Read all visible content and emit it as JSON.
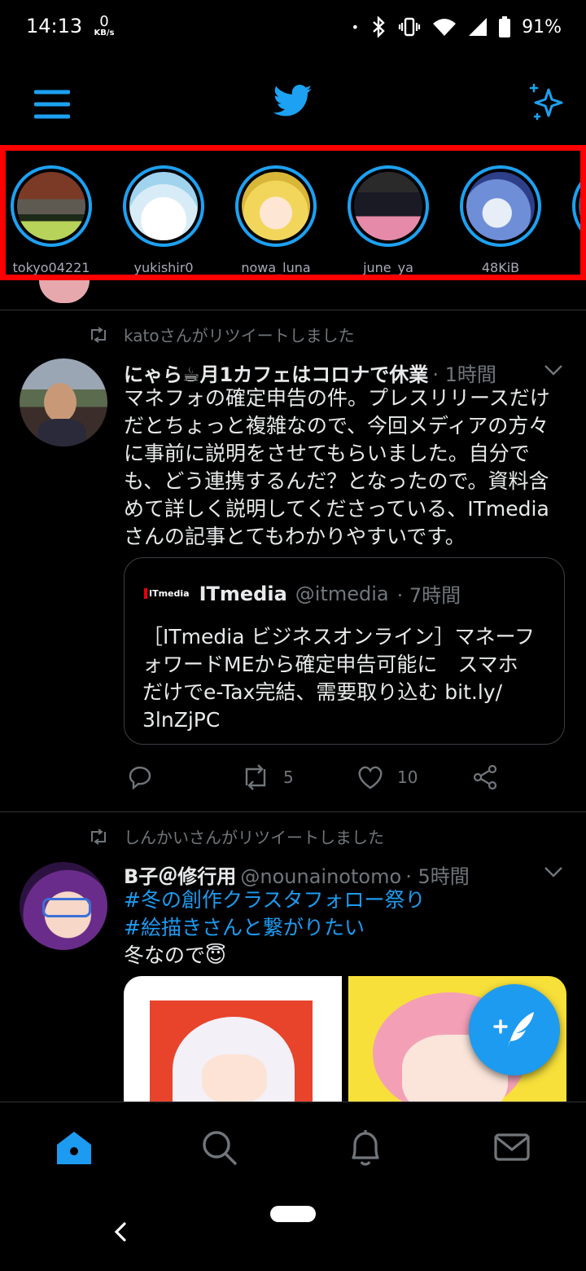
{
  "status_bar": {
    "time": "14:13",
    "net_speed_value": "0",
    "net_speed_unit": "KB/s",
    "dot": "•",
    "battery": "91%"
  },
  "top_bar": {
    "menu_icon": "hamburger-menu-icon",
    "logo_icon": "twitter-bird-icon",
    "sparkle_icon": "sparkle-icon"
  },
  "fleets": [
    {
      "name": "tokyo04221"
    },
    {
      "name": "yukishir0"
    },
    {
      "name": "nowa_luna"
    },
    {
      "name": "june_ya"
    },
    {
      "name": "48KiB"
    }
  ],
  "tweets": [
    {
      "retweeted_by": "katoさんがリツイートしました",
      "author": "にゃら☕月1カフェはコロナで休業",
      "handle": "",
      "time": "· 1時間",
      "body_lines": [
        "マネフォの確定申告の件。プレスリリースだけ",
        "だとちょっと複雑なので、今回メディアの方々",
        "に事前に説明をさせてもらいました。自分で",
        "も、どう連携するんだ？となったので。資料含",
        "めて詳しく説明してくださっている、ITmedia",
        "さんの記事とてもわかりやすいです。"
      ],
      "quote": {
        "logo": "ITmedia",
        "author": "ITmedia",
        "handle": "@itmedia",
        "time": "· 7時間",
        "body_lines": [
          "［ITmedia ビジネスオンライン］マネーフ",
          "ォワードMEから確定申告可能に　スマホ",
          "だけでe-Tax完結、需要取り込む bit.ly/",
          "3lnZjPC"
        ]
      },
      "retweets": "5",
      "likes": "10"
    },
    {
      "retweeted_by": "しんかいさんがリツイートしました",
      "author": "B子＠修行用",
      "handle": "@nounainotomo",
      "time": "· 5時間",
      "hashtag1": "#冬の創作クラスタフォロー祭り",
      "hashtag2": "#絵描きさんと繋がりたい",
      "text": "冬なので😇"
    }
  ],
  "fab_icon": "compose-tweet-icon",
  "bottom_nav": [
    "home-icon",
    "search-icon",
    "notifications-icon",
    "messages-icon"
  ],
  "colors": {
    "accent": "#1da1f2",
    "highlight": "#ff0000",
    "background": "#000000"
  }
}
